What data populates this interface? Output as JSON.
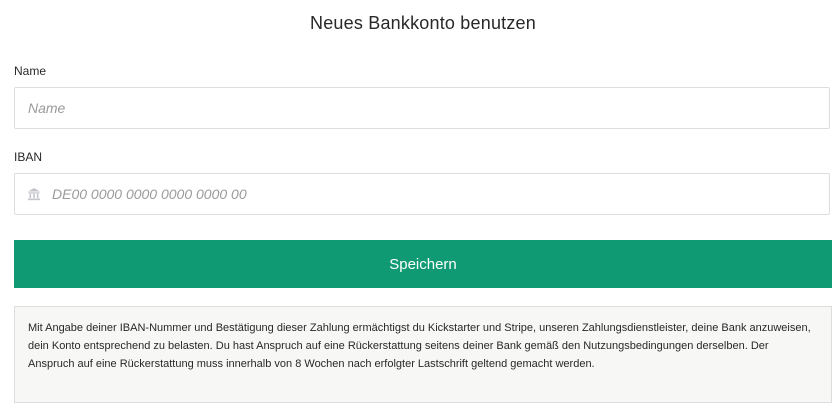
{
  "header": {
    "title": "Neues Bankkonto benutzen"
  },
  "form": {
    "name": {
      "label": "Name",
      "placeholder": "Name",
      "value": ""
    },
    "iban": {
      "label": "IBAN",
      "placeholder": "DE00 0000 0000 0000 0000 00",
      "value": "",
      "icon": "bank-icon"
    },
    "save_label": "Speichern"
  },
  "legal": {
    "text": "Mit Angabe deiner IBAN-Nummer und Bestätigung dieser Zahlung ermächtigst du Kickstarter und Stripe, unseren Zahlungsdienstleister, deine Bank anzuweisen, dein Konto entsprechend zu belasten. Du hast Anspruch auf eine Rückerstattung seitens deiner Bank gemäß den Nutzungsbedingungen derselben. Der Anspruch auf eine Rückerstattung muss innerhalb von 8 Wochen nach erfolgter Lastschrift geltend gemacht werden."
  },
  "colors": {
    "accent": "#0f9a74",
    "text": "#282828",
    "placeholder": "#9b9b9b",
    "border": "#dcdedd",
    "legal_background": "#f7f7f6"
  }
}
